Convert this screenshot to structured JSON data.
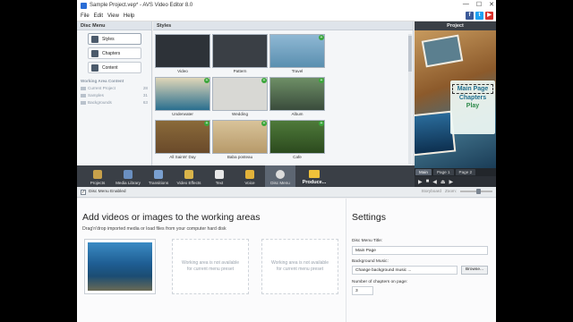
{
  "window": {
    "title": "Sample Project.vep* - AVS Video Editor 8.0",
    "minimize": "—",
    "maximize": "☐",
    "close": "✕"
  },
  "menu": [
    "File",
    "Edit",
    "View",
    "Help"
  ],
  "social": [
    {
      "icon": "facebook-icon",
      "glyph": "f",
      "color": "#3b5998"
    },
    {
      "icon": "twitter-icon",
      "glyph": "t",
      "color": "#1da1f2"
    },
    {
      "icon": "youtube-icon",
      "glyph": "▶",
      "color": "#d9312b"
    }
  ],
  "disc_menu": {
    "header": "Disc Menu",
    "buttons": [
      "Styles",
      "Chapters",
      "Content"
    ],
    "working_area_content": "Working Area Content",
    "folders": [
      {
        "name": "Current Project",
        "count": "28"
      },
      {
        "name": "Samples",
        "count": "31"
      },
      {
        "name": "Backgrounds",
        "count": "63"
      }
    ]
  },
  "styles": {
    "header": "Styles",
    "items": [
      {
        "label": "Video",
        "color": "#2d3238",
        "plus": false
      },
      {
        "label": "Pattern",
        "color": "#3a3f45",
        "plus": false
      },
      {
        "label": "Travel",
        "color": "#5a8fb0",
        "plus": true
      },
      {
        "label": "Underwater",
        "color": "#2a6f8f",
        "plus": true
      },
      {
        "label": "Wedding",
        "color": "#d8d8d4",
        "plus": true
      },
      {
        "label": "Album",
        "color": "#3a4c3c",
        "plus": true
      },
      {
        "label": "All Saints' Day",
        "color": "#6a4a2a",
        "plus": true
      },
      {
        "label": "Baba posteau",
        "color": "#b79a6a",
        "plus": true
      },
      {
        "label": "Cafe",
        "color": "#2c4a1e",
        "plus": true
      }
    ]
  },
  "project": {
    "header": "Project",
    "menu_items": [
      "Main Page",
      "Chapters",
      "Play"
    ],
    "tabs": [
      "Main",
      "Page 1",
      "Page 2"
    ],
    "controls": [
      "▶",
      "■",
      "◀",
      "⏏",
      "▶"
    ]
  },
  "toolbar": {
    "items": [
      {
        "label": "Projects",
        "icon": "projects-icon",
        "color": "#c7a04a"
      },
      {
        "label": "Media Library",
        "icon": "media-library-icon",
        "color": "#6a8fc0"
      },
      {
        "label": "Transitions",
        "icon": "transitions-icon",
        "color": "#7aa0d0"
      },
      {
        "label": "Video Effects",
        "icon": "video-effects-icon",
        "color": "#d9b44a"
      },
      {
        "label": "Text",
        "icon": "text-icon",
        "color": "#e8e8e8"
      },
      {
        "label": "Voice",
        "icon": "voice-icon",
        "color": "#e2b23a"
      },
      {
        "label": "Disc Menu",
        "icon": "disc-menu-icon",
        "color": "#dcdcdc"
      }
    ],
    "produce": "Produce..."
  },
  "disc_menu_bar": {
    "check": "✓",
    "label": "Disc Menu Enabled",
    "storyboard": "Storyboard",
    "zoom": "Zoom:"
  },
  "work_area": {
    "title": "Add videos or images to the working areas",
    "subtitle": "Drag'n'drop imported media or load files from your computer hard disk",
    "placeholder": "Working area is not available for current menu preset"
  },
  "settings": {
    "title": "Settings",
    "menu_title_label": "Disc Menu Title:",
    "menu_title_value": "Main Page",
    "bg_music_label": "Background Music:",
    "bg_music_value": "Change background music ...",
    "browse": "Browse...",
    "chapters_label": "Number of chapters on page:",
    "chapters_value": "3"
  }
}
